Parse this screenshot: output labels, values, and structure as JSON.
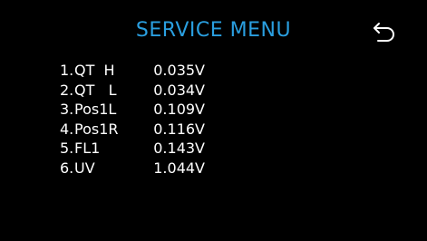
{
  "screen": {
    "title": "SERVICE MENU",
    "title_color": "#2a9fe0",
    "background": "#000000",
    "back_icon": "undo-arrow-icon"
  },
  "readings": [
    {
      "number": "1.",
      "label": "QT  H",
      "value": "0.035V"
    },
    {
      "number": "2.",
      "label": "QT   L",
      "value": "0.034V"
    },
    {
      "number": "3.",
      "label": "Pos1L",
      "value": "0.109V"
    },
    {
      "number": "4.",
      "label": "Pos1R",
      "value": "0.116V"
    },
    {
      "number": "5.",
      "label": "FL1",
      "value": "0.143V"
    },
    {
      "number": "6.",
      "label": "UV",
      "value": "1.044V"
    }
  ]
}
